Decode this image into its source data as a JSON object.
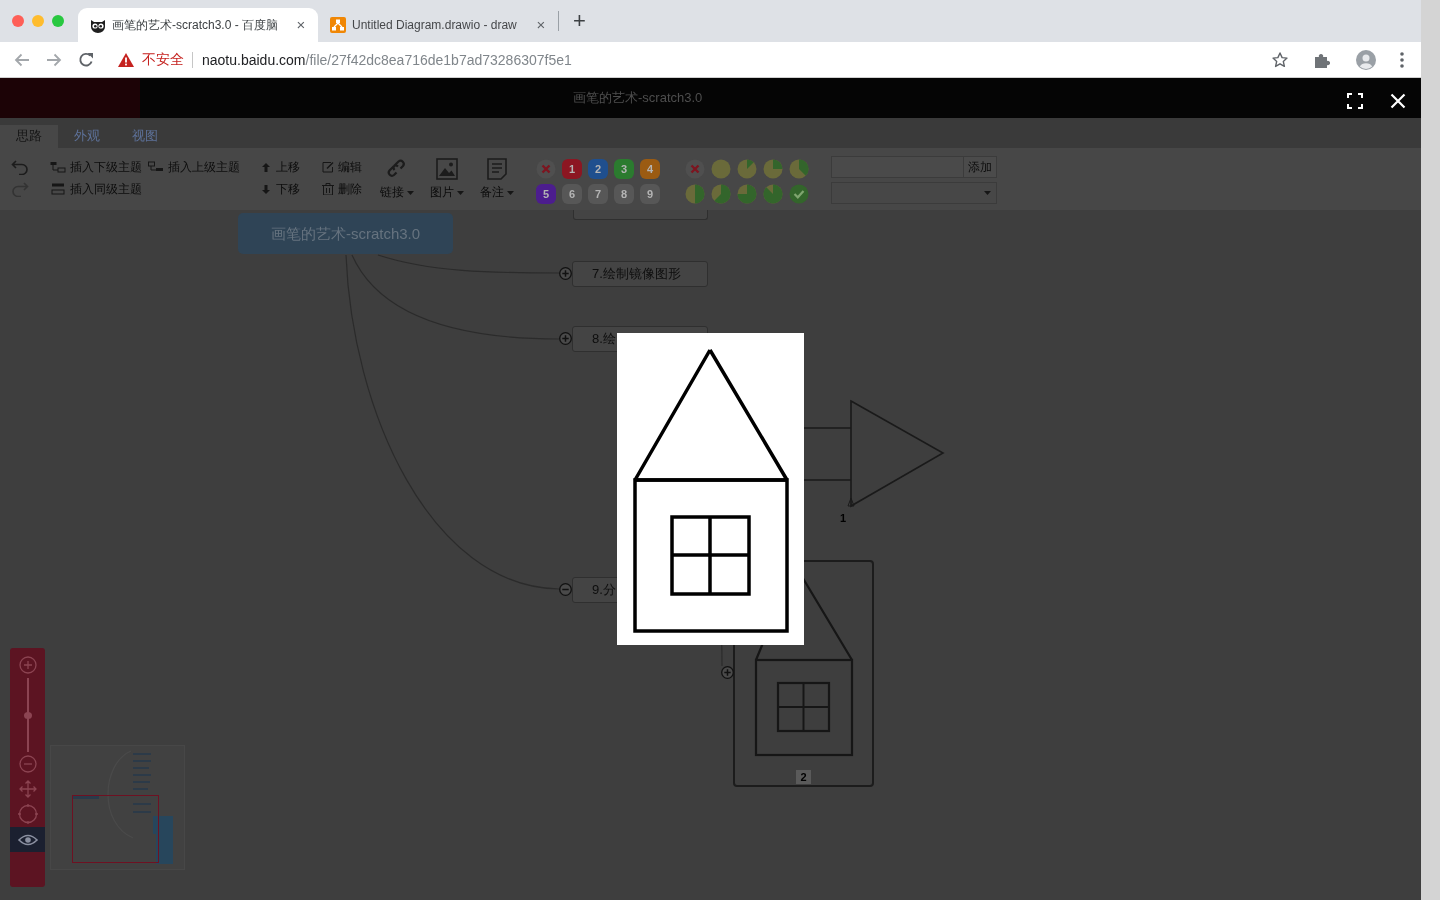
{
  "browser": {
    "tabs": [
      {
        "kind": "owl",
        "title": "画笔的艺术-scratch3.0 - 百度脑",
        "close": "×",
        "selected": true
      },
      {
        "kind": "diagram",
        "title": "Untitled Diagram.drawio - draw",
        "close": "×",
        "selected": false
      }
    ],
    "new_tab": "+",
    "address": {
      "security": "不安全",
      "host": "naotu.baidu.com",
      "path": "/file/27f42dc8ea716de1b7ad73286307f5e1"
    }
  },
  "app": {
    "title": "画笔的艺术-scratch3.0",
    "tabs": [
      {
        "label": "思路",
        "selected": true
      },
      {
        "label": "外观",
        "selected": false
      },
      {
        "label": "视图",
        "selected": false
      }
    ],
    "toolbar": {
      "insert": [
        {
          "kind": "child",
          "label": "插入下级主题"
        },
        {
          "kind": "parent",
          "label": "插入上级主题"
        },
        {
          "kind": "sibling",
          "label": "插入同级主题"
        }
      ],
      "arrange": [
        {
          "kind": "up",
          "label": "上移"
        },
        {
          "kind": "down",
          "label": "下移"
        }
      ],
      "edit": [
        {
          "kind": "edit",
          "label": "编辑"
        },
        {
          "kind": "delete",
          "label": "删除"
        }
      ],
      "menus": [
        {
          "kind": "link",
          "label": "链接"
        },
        {
          "kind": "image",
          "label": "图片"
        },
        {
          "kind": "note",
          "label": "备注"
        }
      ],
      "priority": [
        {
          "kind": "clear"
        },
        {
          "kind": "number",
          "label": "1",
          "color": "#8c1622"
        },
        {
          "kind": "number",
          "label": "2",
          "color": "#1f4f8e"
        },
        {
          "kind": "number",
          "label": "3",
          "color": "#2b7b2f"
        },
        {
          "kind": "number",
          "label": "4",
          "color": "#9b5b12"
        },
        {
          "kind": "number",
          "label": "5",
          "color": "#4c1d8e"
        },
        {
          "kind": "number",
          "label": "6",
          "color": "#575757"
        },
        {
          "kind": "number",
          "label": "7",
          "color": "#575757"
        },
        {
          "kind": "number",
          "label": "8",
          "color": "#575757"
        },
        {
          "kind": "number",
          "label": "9",
          "color": "#575757"
        }
      ],
      "progress": [
        {
          "kind": "clear"
        },
        {
          "kind": "pie"
        },
        {
          "kind": "pie"
        },
        {
          "kind": "pie"
        },
        {
          "kind": "pie"
        },
        {
          "kind": "pie"
        },
        {
          "kind": "pie"
        },
        {
          "kind": "pie"
        },
        {
          "kind": "pie"
        },
        {
          "kind": "done"
        }
      ],
      "resource": {
        "button": "添加"
      }
    }
  },
  "mindmap": {
    "root": "画笔的艺术-scratch3.0",
    "topics": [
      {
        "kind": "clipped"
      },
      {
        "kind": "topic",
        "label": "7.绘制镜像图形",
        "expanded": false
      },
      {
        "kind": "topic",
        "label": "8.绘",
        "expanded": false
      },
      {
        "kind": "topic",
        "label": "9.分",
        "expanded": true
      }
    ],
    "pictures": [
      {
        "kind": "triangle",
        "caption": "1"
      },
      {
        "kind": "house",
        "caption": "2",
        "expanded": false
      }
    ]
  },
  "zoom_panel": {
    "level": 0.5,
    "navigator": {
      "on": true
    }
  },
  "lightbox": {
    "open": true
  }
}
